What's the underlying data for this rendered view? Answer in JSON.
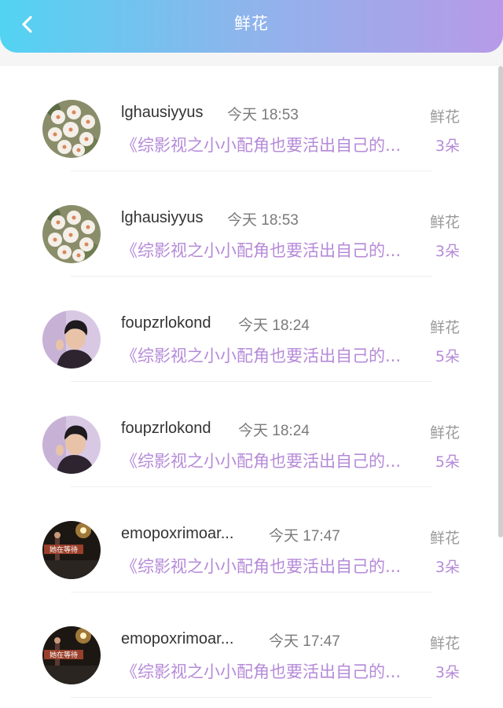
{
  "header": {
    "title": "鲜花",
    "back_icon": "chevron-left-icon"
  },
  "colors": {
    "accent": "#b58ad8",
    "header_start": "#52d3f2",
    "header_end": "#b79ae8"
  },
  "records": [
    {
      "username": "lghausiyyus",
      "time": "今天 18:53",
      "work": "《综影视之小小配角也要活出自己的...",
      "gift_type": "鲜花",
      "count": "3朵",
      "avatar": "flower-avatar"
    },
    {
      "username": "lghausiyyus",
      "time": "今天 18:53",
      "work": "《综影视之小小配角也要活出自己的...",
      "gift_type": "鲜花",
      "count": "3朵",
      "avatar": "flower-avatar"
    },
    {
      "username": "foupzrlokond",
      "time": "今天 18:24",
      "work": "《综影视之小小配角也要活出自己的...",
      "gift_type": "鲜花",
      "count": "5朵",
      "avatar": "man-portrait-avatar"
    },
    {
      "username": "foupzrlokond",
      "time": "今天 18:24",
      "work": "《综影视之小小配角也要活出自己的...",
      "gift_type": "鲜花",
      "count": "5朵",
      "avatar": "man-portrait-avatar"
    },
    {
      "username": "emopoxrimoar...",
      "time": "今天 17:47",
      "work": "《综影视之小小配角也要活出自己的...",
      "gift_type": "鲜花",
      "count": "3朵",
      "avatar": "night-street-avatar",
      "avatar_text": "她在等待"
    },
    {
      "username": "emopoxrimoar...",
      "time": "今天 17:47",
      "work": "《综影视之小小配角也要活出自己的...",
      "gift_type": "鲜花",
      "count": "3朵",
      "avatar": "night-street-avatar",
      "avatar_text": "她在等待"
    }
  ]
}
